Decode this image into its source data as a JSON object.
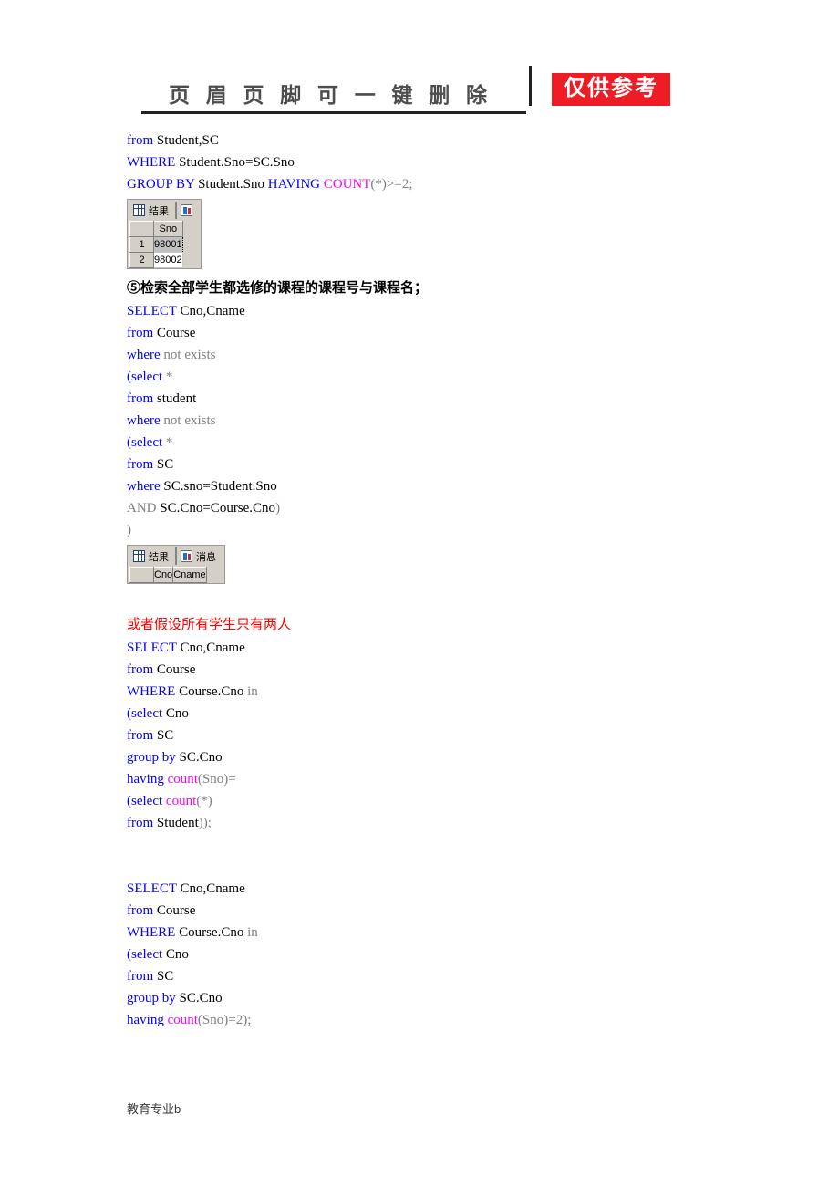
{
  "header": {
    "title": "页 眉 页 脚 可 一 键 删 除",
    "stamp": "仅供参考",
    "stamp_color": "#ee1c25"
  },
  "footer": {
    "text": "教育专业b"
  },
  "theme": {
    "keyword_color": "#0000ff",
    "function_color": "#ff00ff",
    "dim_color": "#808080",
    "plain_color": "#000000",
    "note_color": "#ff0000",
    "widget_face": "#d4d0c8"
  },
  "blocks": {
    "sql1": {
      "l1_kw": "from",
      "l1_rest": " Student,SC",
      "l2_kw": "WHERE",
      "l2_rest": " Student.Sno=SC.Sno",
      "l3_kw1": "GROUP BY",
      "l3_mid": " Student.Sno ",
      "l3_kw2": "HAVING",
      "l3_sp": " ",
      "l3_fn": "COUNT",
      "l3_tail": "(*)>=2;"
    },
    "result1": {
      "tab_results": "结果",
      "columns": [
        "Sno"
      ],
      "rows": [
        {
          "num": "1",
          "values": [
            "98001"
          ],
          "selected": true
        },
        {
          "num": "2",
          "values": [
            "98002"
          ],
          "selected": false
        }
      ]
    },
    "heading5": "⑤检索全部学生都选修的课程的课程号与课程名；",
    "sql2": {
      "l1_kw": "SELECT",
      "l1_rest": " Cno,Cname",
      "l2_kw": "from",
      "l2_rest": " Course",
      "l3_kw": "where",
      "l3_dim": " not exists",
      "l4_open": "(",
      "l4_kw": "select",
      "l4_dim": " *",
      "l5_kw": "from",
      "l5_rest": " student",
      "l6_kw": "where",
      "l6_dim": " not exists",
      "l7_open": "(",
      "l7_kw": "select",
      "l7_dim": " *",
      "l8_kw": "from",
      "l8_rest": " SC",
      "l9_kw": "where",
      "l9_rest": " SC.sno=Student.Sno",
      "l10_dim": "AND",
      "l10_rest": " SC.Cno=Course.Cno",
      "l10_close": ")",
      "l11_close": ")"
    },
    "result2": {
      "tab_results": "结果",
      "tab_messages": "消息",
      "columns": [
        "Cno",
        "Cname"
      ],
      "rows": []
    },
    "note_red": "或者假设所有学生只有两人",
    "sql3": {
      "l1_kw": "SELECT",
      "l1_rest": " Cno,Cname",
      "l2_kw": "from",
      "l2_rest": " Course",
      "l3_kw": "WHERE",
      "l3_rest": " Course.Cno ",
      "l3_dim": "in",
      "l4_open": "(",
      "l4_kw": "select",
      "l4_rest": " Cno",
      "l5_kw": "from",
      "l5_rest": " SC",
      "l6_kw": "group by",
      "l6_rest": " SC.Cno",
      "l7_kw": "having",
      "l7_sp": " ",
      "l7_fn": "count",
      "l7_tail": "(Sno)=",
      "l8_open": "(",
      "l8_kw": "select",
      "l8_sp": " ",
      "l8_fn": "count",
      "l8_tail": "(*)",
      "l9_kw": "from",
      "l9_rest": " Student",
      "l9_close": "));"
    },
    "sql4": {
      "l1_kw": "SELECT",
      "l1_rest": " Cno,Cname",
      "l2_kw": "from",
      "l2_rest": " Course",
      "l3_kw": "WHERE",
      "l3_rest": " Course.Cno ",
      "l3_dim": "in",
      "l4_open": "(",
      "l4_kw": "select",
      "l4_rest": " Cno",
      "l5_kw": "from",
      "l5_rest": " SC",
      "l6_kw": "group by",
      "l6_rest": " SC.Cno",
      "l7_kw": "having",
      "l7_sp": " ",
      "l7_fn": "count",
      "l7_tail": "(Sno)=2);"
    }
  }
}
